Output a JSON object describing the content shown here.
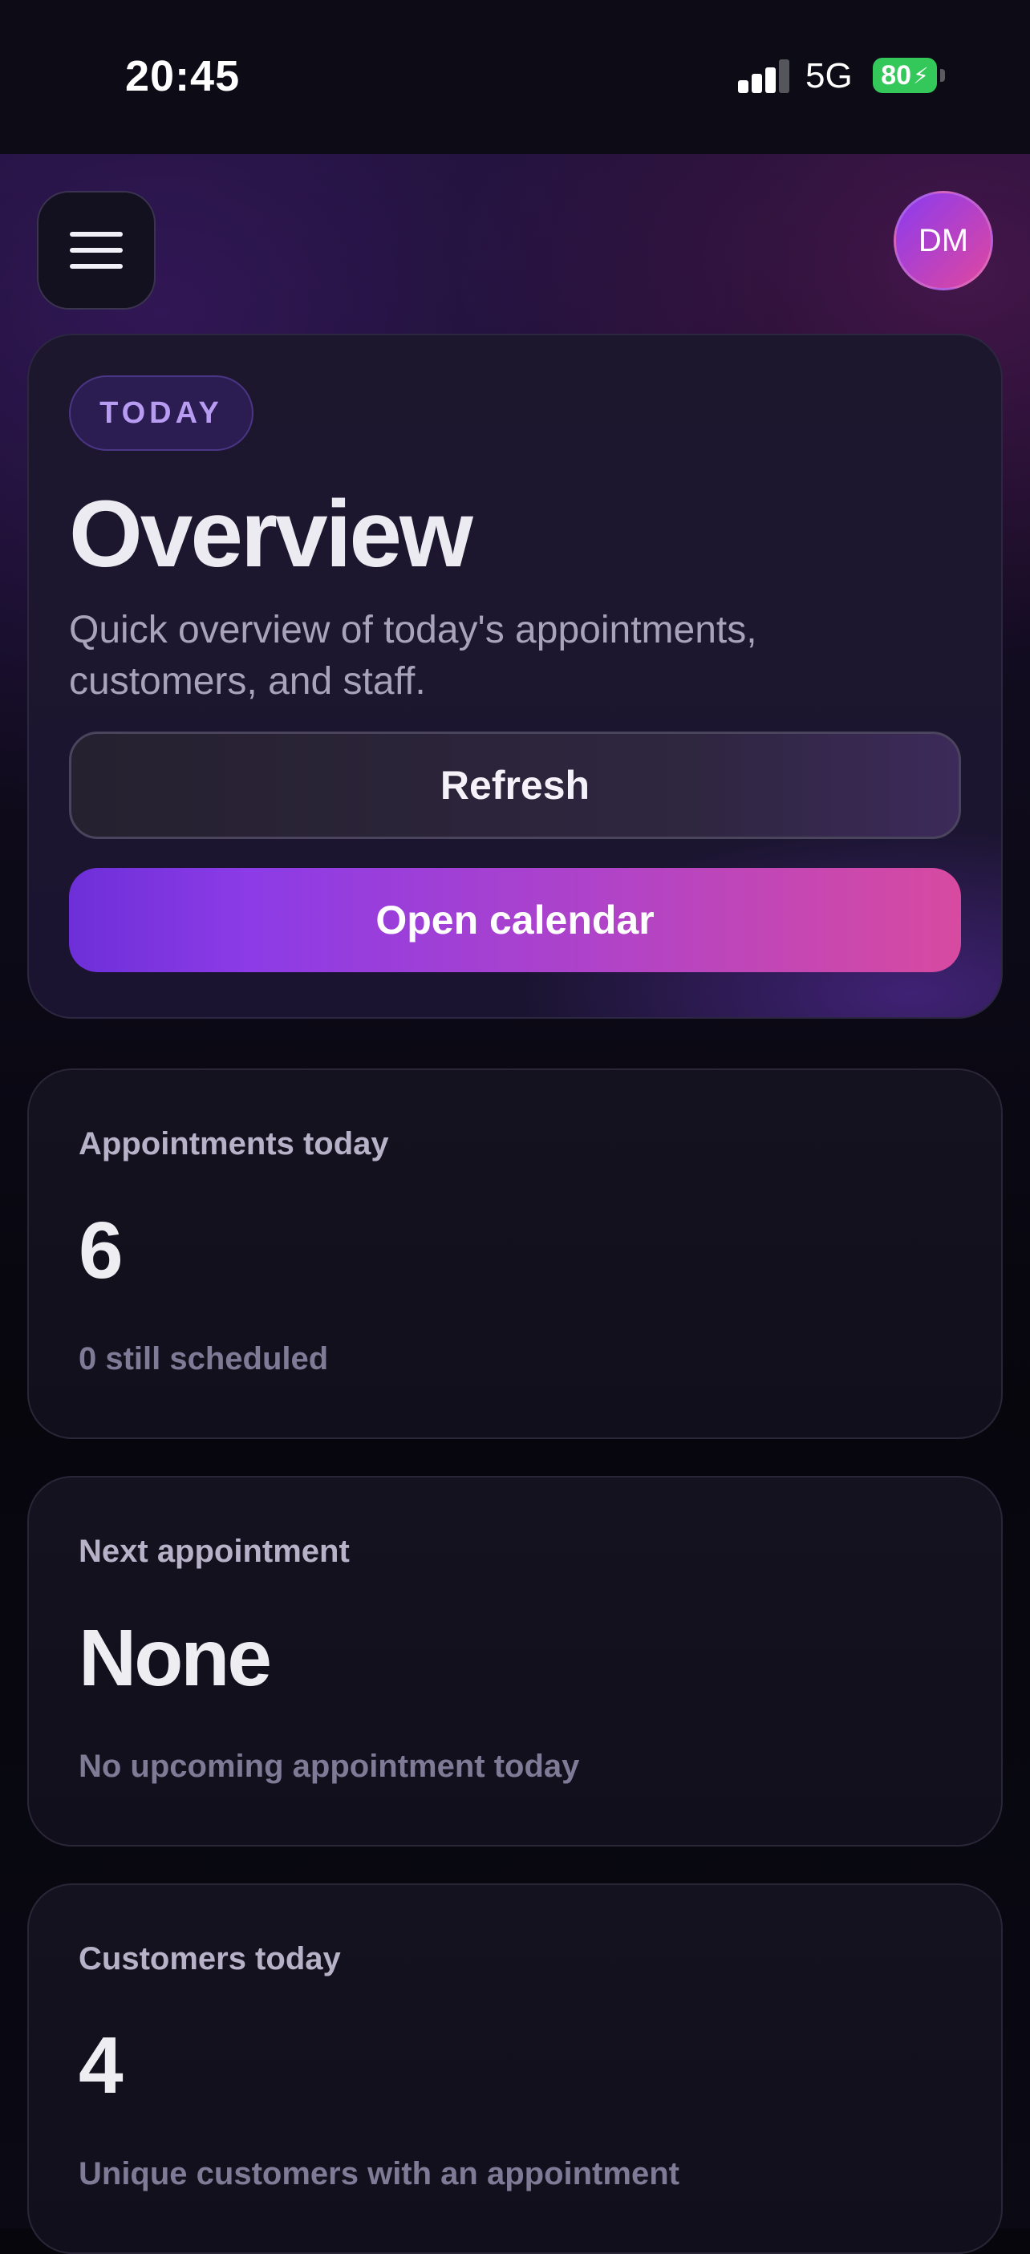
{
  "status_bar": {
    "time": "20:45",
    "network": "5G",
    "battery": "80",
    "battery_color": "#34c759"
  },
  "header": {
    "menu_icon": "hamburger-menu-icon",
    "avatar_initials": "DM"
  },
  "hero": {
    "badge": "TODAY",
    "title": "Overview",
    "subtitle": "Quick overview of today's appointments, customers, and staff.",
    "refresh_label": "Refresh",
    "calendar_label": "Open calendar"
  },
  "cards": [
    {
      "label": "Appointments today",
      "value": "6",
      "note": "0 still scheduled"
    },
    {
      "label": "Next appointment",
      "value": "None",
      "note": "No upcoming appointment today"
    },
    {
      "label": "Customers today",
      "value": "4",
      "note": "Unique customers with an appointment"
    }
  ],
  "colors": {
    "accent_start": "#6d2fd8",
    "accent_end": "#d74aa0",
    "badge_text": "#b89cf2"
  }
}
